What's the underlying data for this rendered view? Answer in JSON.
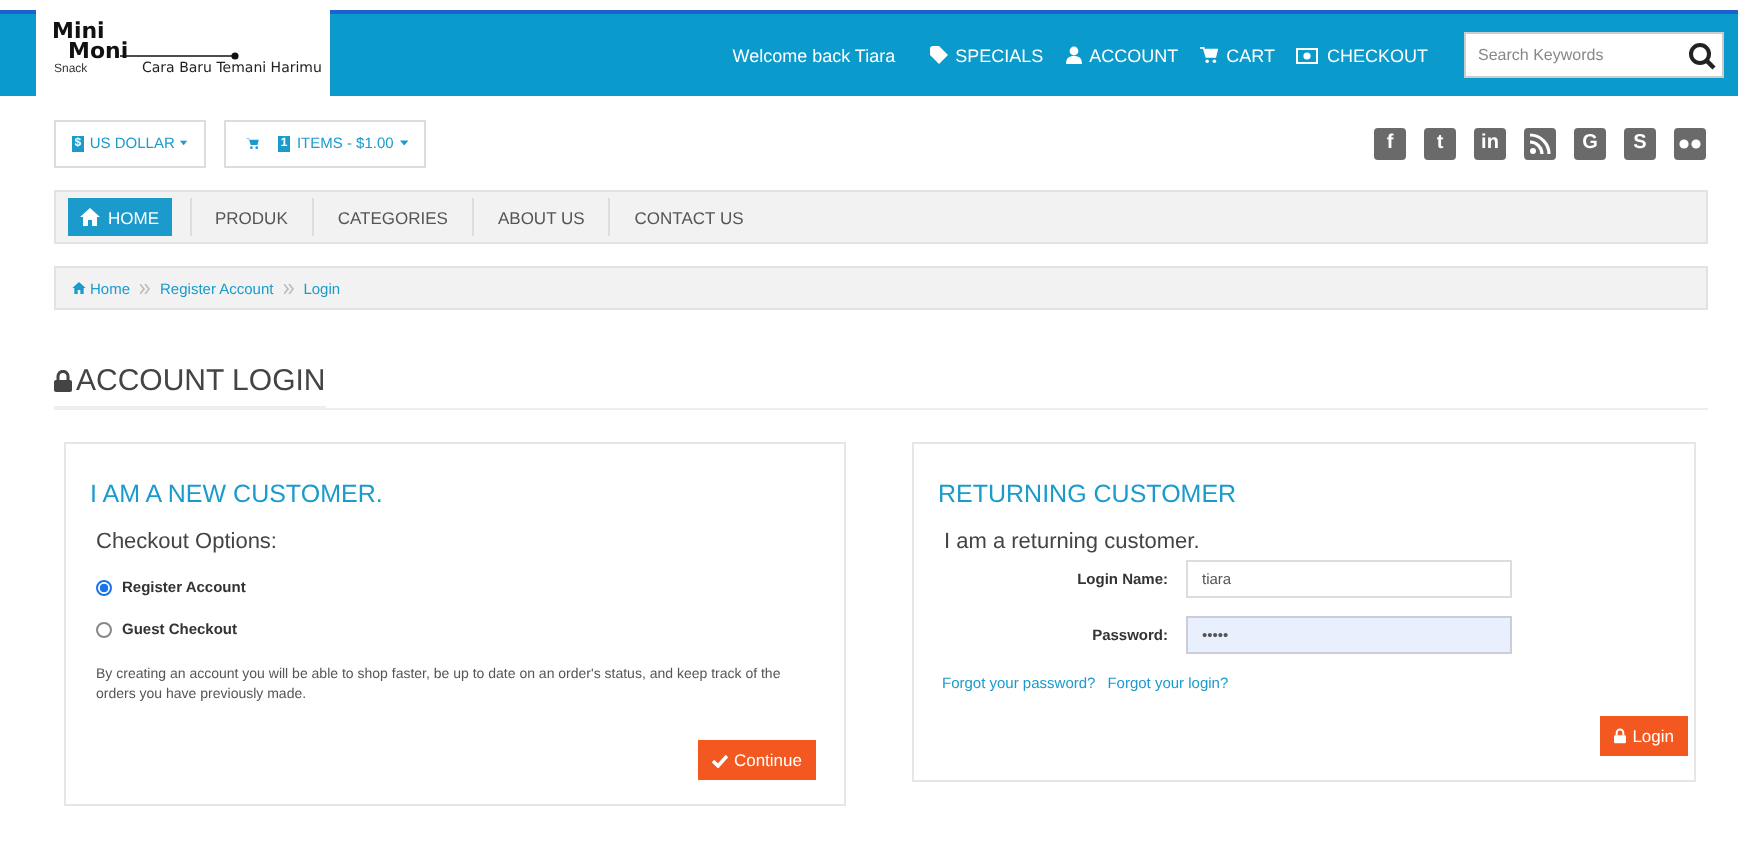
{
  "logo": {
    "name_top": "Mini",
    "name_bottom": "Moni",
    "sub": "Snack",
    "tagline": "Cara Baru Temani Harimu"
  },
  "header": {
    "welcome": "Welcome back Tiara",
    "menu": [
      "SPECIALS",
      "ACCOUNT",
      "CART",
      "CHECKOUT"
    ],
    "search": {
      "placeholder": "Search Keywords"
    }
  },
  "toolbar": {
    "currency": {
      "badge": "$",
      "label": "US DOLLAR"
    },
    "cart": {
      "badge": "1",
      "label": "ITEMS - $1.00"
    }
  },
  "social": [
    {
      "kind": "letter",
      "glyph": "f"
    },
    {
      "kind": "letter",
      "glyph": "t"
    },
    {
      "kind": "letter",
      "glyph": "in"
    },
    {
      "kind": "rss"
    },
    {
      "kind": "letter",
      "glyph": "G"
    },
    {
      "kind": "letter",
      "glyph": "S"
    },
    {
      "kind": "dots"
    }
  ],
  "nav": [
    {
      "label": "HOME",
      "selected": true
    },
    {
      "label": "PRODUK",
      "selected": false
    },
    {
      "label": "CATEGORIES",
      "selected": false
    },
    {
      "label": "ABOUT US",
      "selected": false
    },
    {
      "label": "CONTACT US",
      "selected": false
    }
  ],
  "breadcrumb": [
    "Home",
    "Register Account",
    "Login"
  ],
  "page_title": "ACCOUNT LOGIN",
  "new_customer": {
    "title": "I AM A NEW CUSTOMER.",
    "subtitle": "Checkout Options:",
    "options": [
      {
        "label": "Register Account",
        "selected": true
      },
      {
        "label": "Guest Checkout",
        "selected": false
      }
    ],
    "note": "By creating an account you will be able to shop faster, be up to date on an order's status, and keep track of the orders you have previously made.",
    "button": "Continue"
  },
  "returning_customer": {
    "title": "RETURNING CUSTOMER",
    "subtitle": "I am a returning customer.",
    "fields": [
      {
        "label": "Login Name:",
        "value": "tiara",
        "focused": false
      },
      {
        "label": "Password:",
        "value": "•••••",
        "focused": true
      }
    ],
    "links": [
      "Forgot your password?",
      "Forgot your login?"
    ],
    "button": "Login"
  }
}
